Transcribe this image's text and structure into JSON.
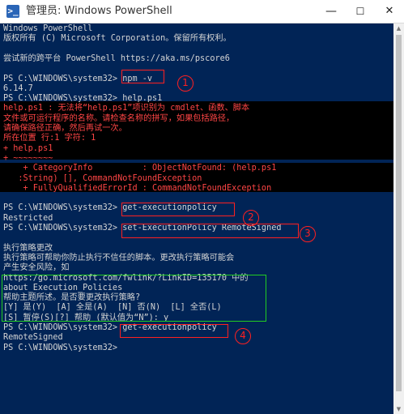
{
  "window": {
    "title": "管理员: Windows PowerShell",
    "icon_glyph": ">_",
    "minimize_glyph": "—",
    "maximize_glyph": "☐",
    "close_glyph": "✕"
  },
  "colors": {
    "console_bg": "#012456",
    "text": "#d4d4d4",
    "error_text": "#ff4545",
    "error_bg": "#000000",
    "annotation_red": "#ff2020",
    "annotation_green": "#22cc22"
  },
  "console": {
    "lines": [
      {
        "text": "Windows PowerShell",
        "type": "normal"
      },
      {
        "text": "版权所有 (C) Microsoft Corporation。保留所有权利。",
        "type": "normal"
      },
      {
        "text": "",
        "type": "normal"
      },
      {
        "text": "尝试新的跨平台 PowerShell https://aka.ms/pscore6",
        "type": "normal"
      },
      {
        "text": "",
        "type": "normal"
      },
      {
        "text": "PS C:\\WINDOWS\\system32> npm -v",
        "type": "normal"
      },
      {
        "text": "6.14.7",
        "type": "normal"
      },
      {
        "text": "PS C:\\WINDOWS\\system32> help.ps1",
        "type": "normal"
      },
      {
        "text": "help.ps1 : 无法将“help.ps1”项识别为 cmdlet、函数、脚本",
        "type": "error"
      },
      {
        "text": "文件或可运行程序的名称。请检查名称的拼写，如果包括路径，",
        "type": "error"
      },
      {
        "text": "请确保路径正确，然后再试一次。",
        "type": "error"
      },
      {
        "text": "所在位置 行:1 字符: 1",
        "type": "error"
      },
      {
        "text": "+ help.ps1",
        "type": "error"
      },
      {
        "text": "+ ~~~~~~~~",
        "type": "error"
      },
      {
        "text": "    + CategoryInfo          : ObjectNotFound: (help.ps1",
        "type": "error"
      },
      {
        "text": "   :String) [], CommandNotFoundException",
        "type": "error"
      },
      {
        "text": "    + FullyQualifiedErrorId : CommandNotFoundException",
        "type": "error"
      },
      {
        "text": "",
        "type": "normal"
      },
      {
        "text": "PS C:\\WINDOWS\\system32> get-executionpolicy",
        "type": "normal"
      },
      {
        "text": "Restricted",
        "type": "normal"
      },
      {
        "text": "PS C:\\WINDOWS\\system32> set-ExecutionPolicy RemoteSigned",
        "type": "normal"
      },
      {
        "text": "",
        "type": "normal"
      },
      {
        "text": "执行策略更改",
        "type": "normal"
      },
      {
        "text": "执行策略可帮助你防止执行不信任的脚本。更改执行策略可能会",
        "type": "normal"
      },
      {
        "text": "产生安全风险，如",
        "type": "normal"
      },
      {
        "text": "https:/go.microsoft.com/fwlink/?LinkID=135170 中的",
        "type": "normal"
      },
      {
        "text": "about_Execution_Policies",
        "type": "normal"
      },
      {
        "text": "帮助主题所述。是否要更改执行策略?",
        "type": "normal"
      },
      {
        "text": "[Y] 是(Y)  [A] 全是(A)  [N] 否(N)  [L] 全否(L)",
        "type": "normal"
      },
      {
        "text": "[S] 暂停(S)[?] 帮助 (默认值为“N”): y",
        "type": "normal"
      },
      {
        "text": "PS C:\\WINDOWS\\system32> get-executionpolicy",
        "type": "normal"
      },
      {
        "text": "RemoteSigned",
        "type": "normal"
      },
      {
        "text": "PS C:\\WINDOWS\\system32>",
        "type": "normal"
      }
    ]
  },
  "annotations": {
    "markers": [
      "1",
      "2",
      "3",
      "4"
    ]
  }
}
